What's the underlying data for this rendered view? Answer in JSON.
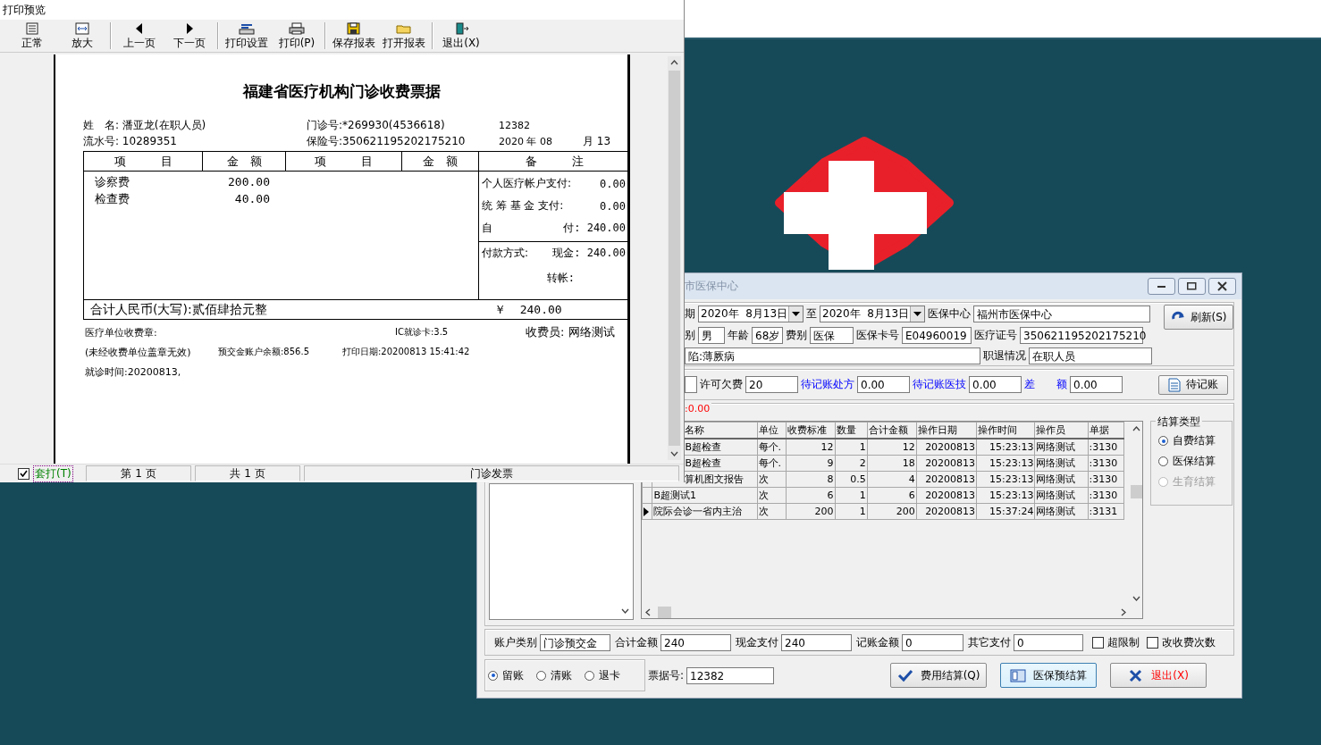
{
  "print_preview": {
    "title": "打印预览",
    "toolbar": [
      [
        "正常",
        "放大"
      ],
      [
        "上一页",
        "下一页"
      ],
      [
        "打印设置",
        "打印(P)"
      ],
      [
        "保存报表",
        "打开报表"
      ],
      [
        "退出(X)"
      ]
    ],
    "receipt": {
      "title": "福建省医疗机构门诊收费票据",
      "info_rows": [
        [
          "姓　名: 潘亚龙(在职人员)",
          "门诊号:*269930(4536618)",
          "12382",
          ""
        ],
        [
          "流水号: 10289351",
          "保险号:350621195202175210",
          "2020 年 08",
          "月 13"
        ]
      ],
      "columns": [
        "项　　　目",
        "金　额",
        "项　　　目",
        "金　额",
        "备　　　注"
      ],
      "items": [
        {
          "name": "诊察费",
          "amount": "200.00"
        },
        {
          "name": "检查费",
          "amount": "40.00"
        }
      ],
      "remarks": [
        {
          "label": "个人医疗帐户支付:",
          "value": "0.00"
        },
        {
          "label": "统 筹 基 金 支付:",
          "value": "0.00"
        },
        {
          "label": "自",
          "value": "付: 240.00"
        }
      ],
      "payment": {
        "label": "付款方式:",
        "cash": "现金: 240.00",
        "transfer": "转帐:"
      },
      "total_words": "合计人民币(大写):贰佰肆拾元整",
      "total_amount": "￥  240.00",
      "footer": [
        [
          "医疗单位收费章:",
          "IC就诊卡:3.5",
          "收费员: 网络测试"
        ],
        [
          "(未经收费单位盖章无效)",
          "预交金账户余额:856.5",
          "打印日期:20200813 15:41:42"
        ],
        [
          "就诊时间:20200813,"
        ]
      ]
    },
    "status_bar": {
      "overlay_print": {
        "label": "套打(T)",
        "checked": true
      },
      "panes": [
        "第 1 页",
        "共 1 页",
        "门诊发票"
      ]
    }
  },
  "dialog": {
    "title": "市医保中心",
    "date_label": "期",
    "date_from": "2020年  8月13日",
    "to_label": "至",
    "date_to": "2020年  8月13日",
    "center_label": "医保中心",
    "center": "福州市医保中心",
    "refresh": "刷新(S)",
    "row2": [
      {
        "label": "别",
        "value": "男"
      },
      {
        "label": "年龄",
        "value": "68岁"
      },
      {
        "label": "费别",
        "value": "医保"
      },
      {
        "label": "医保卡号",
        "value": "E04960019"
      },
      {
        "label": "医疗证号",
        "value": "350621195202175210"
      }
    ],
    "diagnosis": "陷:薄厥病",
    "job_label": "职退情况",
    "job": "在职人员",
    "row4": [
      {
        "label": "许可欠费",
        "value": "20",
        "highlight": false
      },
      {
        "label": "待记账处方",
        "value": "0.00",
        "highlight": true
      },
      {
        "label": "待记账医技",
        "value": "0.00",
        "highlight": true
      },
      {
        "label": "差　　额",
        "value": "0.00",
        "highlight": true
      }
    ],
    "pending_button": "待记账",
    "group_caption": ":0.00",
    "grid": {
      "columns": [
        "名称",
        "单位",
        "收费标准",
        "数量",
        "合计金额",
        "操作日期",
        "操作时间",
        "操作员",
        "单据"
      ],
      "rows": [
        {
          "current": false,
          "cells": [
            "B超检查",
            "每个.",
            "12",
            "1",
            "12",
            "20200813",
            "15:23:13",
            "网络测试",
            ":3130"
          ]
        },
        {
          "current": false,
          "cells": [
            "B超检查",
            "每个.",
            "9",
            "2",
            "18",
            "20200813",
            "15:23:13",
            "网络测试",
            ":3130"
          ]
        },
        {
          "current": false,
          "cells": [
            "算机图文报告",
            "次",
            "8",
            "0.5",
            "4",
            "20200813",
            "15:23:13",
            "网络测试",
            ":3130"
          ]
        },
        {
          "current": false,
          "cells": [
            "B超测试1",
            "次",
            "6",
            "1",
            "6",
            "20200813",
            "15:23:13",
            "网络测试",
            ":3130"
          ]
        },
        {
          "current": true,
          "cells": [
            "院际会诊一省内主治",
            "次",
            "200",
            "1",
            "200",
            "20200813",
            "15:37:24",
            "网络测试",
            ":3131"
          ]
        }
      ]
    },
    "settlement": {
      "title": "结算类型",
      "options": [
        {
          "label": "自费结算",
          "selected": true,
          "disabled": false
        },
        {
          "label": "医保结算",
          "selected": false,
          "disabled": false
        },
        {
          "label": "生育结算",
          "selected": false,
          "disabled": true
        }
      ]
    },
    "totals": [
      {
        "label": "账户类别",
        "value": "门诊预交金"
      },
      {
        "label": "合计金额",
        "value": "240"
      },
      {
        "label": "现金支付",
        "value": "240"
      },
      {
        "label": "记账金额",
        "value": "0"
      },
      {
        "label": "其它支付",
        "value": "0"
      }
    ],
    "checks": [
      {
        "label": "超限制",
        "checked": false
      },
      {
        "label": "改收费次数",
        "checked": false
      }
    ],
    "account_mode": [
      {
        "label": "留账",
        "selected": true
      },
      {
        "label": "清账",
        "selected": false
      },
      {
        "label": "退卡",
        "selected": false
      }
    ],
    "ticket_label": "票据号:",
    "ticket": "12382",
    "buttons": [
      "费用结算(Q)",
      "医保预结算",
      "退出(X)"
    ]
  }
}
